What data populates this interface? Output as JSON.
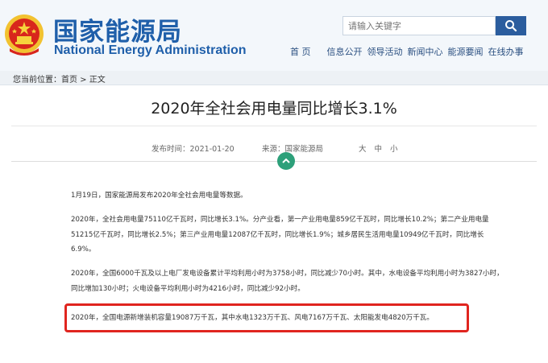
{
  "site": {
    "name_cn": "国家能源局",
    "name_en": "National Energy Administration"
  },
  "search": {
    "placeholder": "请输入关键字"
  },
  "nav": {
    "items": [
      "首 页",
      "信息公开",
      "领导活动",
      "新闻中心",
      "能源要闻",
      "在线办事"
    ]
  },
  "breadcrumb": {
    "prefix": "您当前位置：",
    "home": "首页",
    "sep": " > ",
    "current": "正文"
  },
  "article": {
    "title": "2020年全社会用电量同比增长3.1%",
    "date_label": "发布时间：",
    "date": "2021-01-20",
    "source_label": "来源：",
    "source": "国家能源局",
    "font_sizes": [
      "大",
      "中",
      "小"
    ],
    "paragraphs": [
      "1月19日，国家能源局发布2020年全社会用电量等数据。",
      "2020年，全社会用电量75110亿千瓦时，同比增长3.1%。分产业看，第一产业用电量859亿千瓦时，同比增长10.2%；第二产业用电量51215亿千瓦时，同比增长2.5%；第三产业用电量12087亿千瓦时，同比增长1.9%；城乡居民生活用电量10949亿千瓦时，同比增长6.9%。",
      "2020年，全国6000千瓦及以上电厂发电设备累计平均利用小时为3758小时，同比减少70小时。其中，水电设备平均利用小时为3827小时，同比增加130小时；火电设备平均利用小时为4216小时，同比减少92小时。",
      "2020年，全国电源新增装机容量19087万千瓦，其中水电1323万千瓦、风电7167万千瓦、太阳能发电4820万千瓦。"
    ]
  },
  "colors": {
    "brand_blue": "#1f5faa",
    "highlight_red": "#e0251f",
    "qr_green": "#2da07a"
  }
}
